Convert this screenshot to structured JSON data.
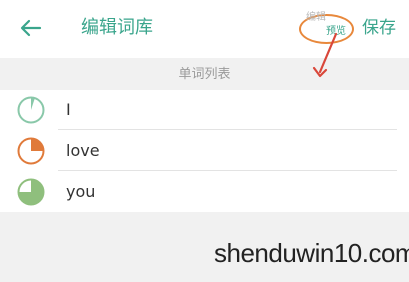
{
  "header": {
    "back_icon": "back-arrow-icon",
    "title": "编辑词库",
    "toggle": {
      "edit_label": "编辑",
      "preview_label": "预览"
    },
    "save_label": "保存"
  },
  "list": {
    "section_title": "单词列表",
    "words": [
      {
        "text": "I",
        "progress": 0.05,
        "color": "#89c8a9"
      },
      {
        "text": "love",
        "progress": 0.25,
        "color": "#e07a3a"
      },
      {
        "text": "you",
        "progress": 0.75,
        "color": "#8fbf7d"
      }
    ]
  },
  "watermark": "shenduwin10.com",
  "colors": {
    "accent": "#3aa58c",
    "highlight": "#e8883b",
    "annotation_arrow": "#d9473a"
  }
}
